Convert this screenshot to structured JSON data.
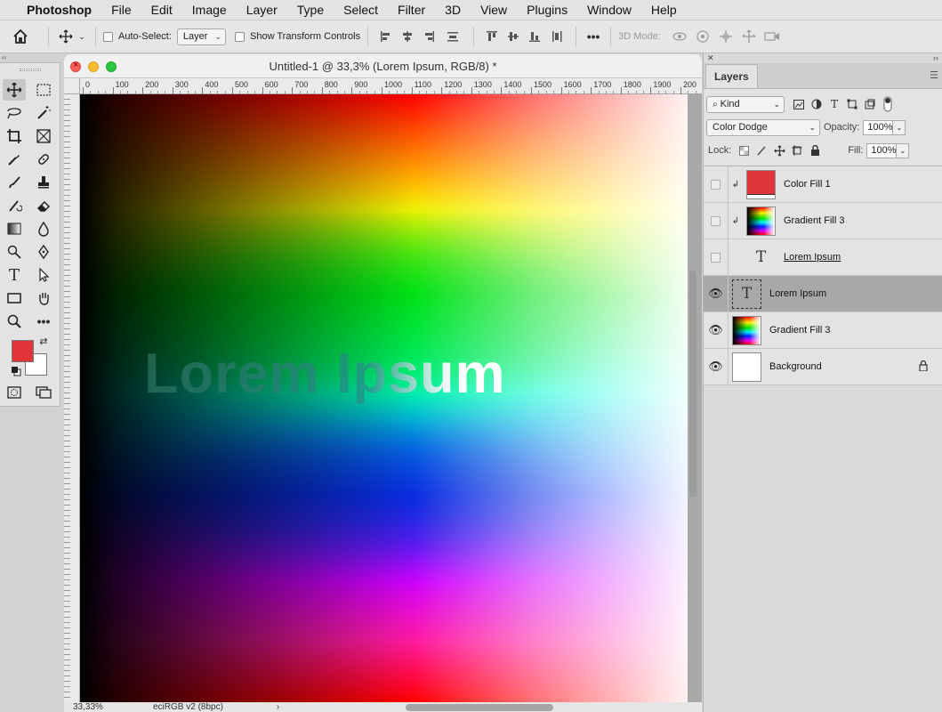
{
  "menubar": {
    "app_name": "Photoshop",
    "items": [
      "File",
      "Edit",
      "Image",
      "Layer",
      "Type",
      "Select",
      "Filter",
      "3D",
      "View",
      "Plugins",
      "Window",
      "Help"
    ]
  },
  "options_bar": {
    "auto_select_label": "Auto-Select:",
    "auto_select_target": "Layer",
    "show_transform_label": "Show Transform Controls",
    "three_d_mode_label": "3D Mode:"
  },
  "colors": {
    "foreground": "#e2353a",
    "background": "#ffffff"
  },
  "document": {
    "title": "Untitled-1 @ 33,3% (Lorem Ipsum, RGB/8) *",
    "ruler_labels": [
      "0",
      "100",
      "200",
      "300",
      "400",
      "500",
      "600",
      "700",
      "800",
      "900",
      "1000",
      "1100",
      "1200",
      "1300",
      "1400",
      "1500",
      "1600",
      "1700",
      "1800",
      "1900",
      "200"
    ],
    "canvas_text": "Lorem Ipsum",
    "zoom": "33,33%",
    "color_profile": "eciRGB v2 (8bpc)",
    "status_arrow": "›"
  },
  "layers_panel": {
    "tab_label": "Layers",
    "filter_kind": "Kind",
    "blend_mode": "Color Dodge",
    "opacity_label": "Opacity:",
    "opacity_value": "100%",
    "lock_label": "Lock:",
    "fill_label": "Fill:",
    "fill_value": "100%",
    "layers": [
      {
        "name": "Color Fill 1",
        "visible": false,
        "clipped": true,
        "thumb": "red"
      },
      {
        "name": "Gradient Fill 3",
        "visible": false,
        "clipped": true,
        "thumb": "gradient"
      },
      {
        "name": "Lorem Ipsum",
        "visible": false,
        "clipped": false,
        "thumb": "text"
      },
      {
        "name": "Lorem Ipsum",
        "visible": true,
        "clipped": false,
        "thumb": "text",
        "selected": true
      },
      {
        "name": "Gradient Fill 3",
        "visible": true,
        "clipped": false,
        "thumb": "gradient"
      },
      {
        "name": "Background",
        "visible": true,
        "clipped": false,
        "thumb": "white",
        "locked": true
      }
    ]
  }
}
